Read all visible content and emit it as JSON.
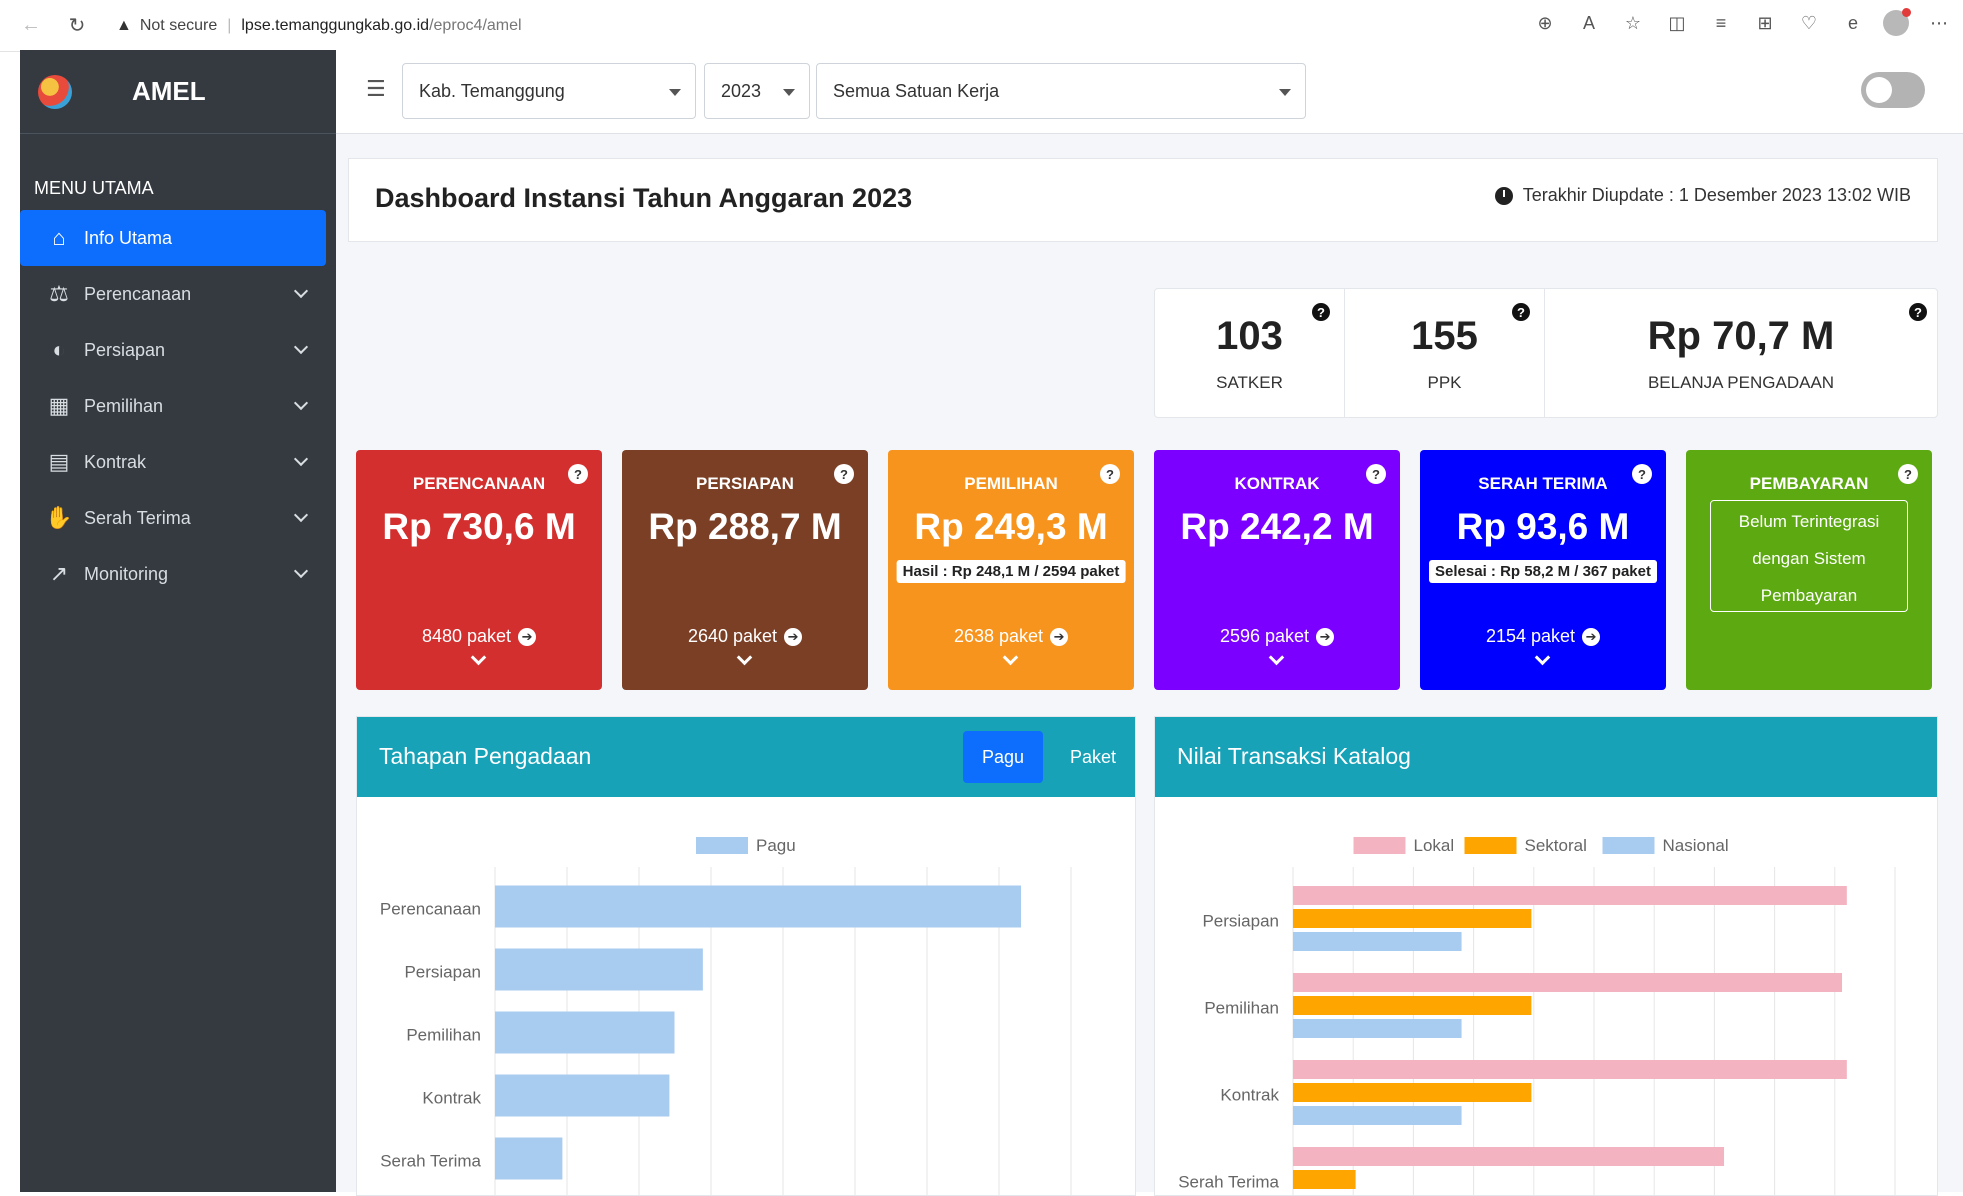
{
  "browser": {
    "not_secure": "Not secure",
    "url_host": "lpse.temanggungkab.go.id",
    "url_path": "/eproc4/amel"
  },
  "sidebar": {
    "brand": "AMEL",
    "menu_header": "MENU UTAMA",
    "items": [
      {
        "label": "Info Utama",
        "icon": "home-icon",
        "active": true
      },
      {
        "label": "Perencanaan",
        "icon": "balance-scale-icon"
      },
      {
        "label": "Persiapan",
        "icon": "half-circle-icon"
      },
      {
        "label": "Pemilihan",
        "icon": "calendar-check-icon"
      },
      {
        "label": "Kontrak",
        "icon": "document-icon"
      },
      {
        "label": "Serah Terima",
        "icon": "handshake-icon"
      },
      {
        "label": "Monitoring",
        "icon": "chart-line-icon"
      }
    ]
  },
  "filters": {
    "instansi": "Kab. Temanggung",
    "tahun": "2023",
    "satker": "Semua Satuan Kerja"
  },
  "header": {
    "title": "Dashboard Instansi Tahun Anggaran 2023",
    "updated": "Terakhir Diupdate : 1 Desember 2023 13:02 WIB"
  },
  "stats": [
    {
      "value": "103",
      "label": "SATKER"
    },
    {
      "value": "155",
      "label": "PPK"
    },
    {
      "value": "Rp 70,7 M",
      "label": "BELANJA PENGADAAN"
    }
  ],
  "stages": [
    {
      "title": "PERENCANAAN",
      "value": "Rp 730,6 M",
      "paket": "8480 paket",
      "color": "#d32f2f"
    },
    {
      "title": "PERSIAPAN",
      "value": "Rp 288,7 M",
      "paket": "2640 paket",
      "color": "#7b3f26"
    },
    {
      "title": "PEMILIHAN",
      "value": "Rp 249,3 M",
      "note": "Hasil : Rp 248,1 M / 2594 paket",
      "paket": "2638 paket",
      "color": "#f7941d"
    },
    {
      "title": "KONTRAK",
      "value": "Rp 242,2 M",
      "paket": "2596 paket",
      "color": "#7b00ff"
    },
    {
      "title": "SERAH TERIMA",
      "value": "Rp 93,6 M",
      "note": "Selesai : Rp 58,2 M / 367 paket",
      "paket": "2154 paket",
      "color": "#0000ff"
    },
    {
      "title": "PEMBAYARAN",
      "box_lines": [
        "Belum Terintegrasi",
        "dengan Sistem",
        "Pembayaran"
      ],
      "color": "#5ca912"
    }
  ],
  "tahapan_panel": {
    "title": "Tahapan Pengadaan",
    "tab_pagu": "Pagu",
    "tab_paket": "Paket"
  },
  "katalog_panel": {
    "title": "Nilai Transaksi Katalog"
  },
  "chart_data": [
    {
      "type": "bar",
      "orientation": "horizontal",
      "categories": [
        "Perencanaan",
        "Persiapan",
        "Pemilihan",
        "Kontrak",
        "Serah Terima"
      ],
      "series": [
        {
          "name": "Pagu",
          "values": [
            730.6,
            288.7,
            249.3,
            242.2,
            93.6
          ],
          "color": "#a8cbf0"
        }
      ],
      "xlim": [
        0,
        800
      ],
      "grid": true,
      "legend": "top"
    },
    {
      "type": "bar",
      "orientation": "horizontal",
      "categories": [
        "Persiapan",
        "Pemilihan",
        "Kontrak",
        "Serah Terima"
      ],
      "series": [
        {
          "name": "Lokal",
          "values": [
            46,
            45.6,
            46,
            35.8
          ],
          "color": "#f4b3c0"
        },
        {
          "name": "Sektoral",
          "values": [
            19.8,
            19.8,
            19.8,
            5.2
          ],
          "color": "#ffa500"
        },
        {
          "name": "Nasional",
          "values": [
            14,
            14,
            14,
            0
          ],
          "color": "#a8cbf0"
        }
      ],
      "xlim": [
        0,
        50
      ],
      "grid": true,
      "legend": "top"
    }
  ]
}
